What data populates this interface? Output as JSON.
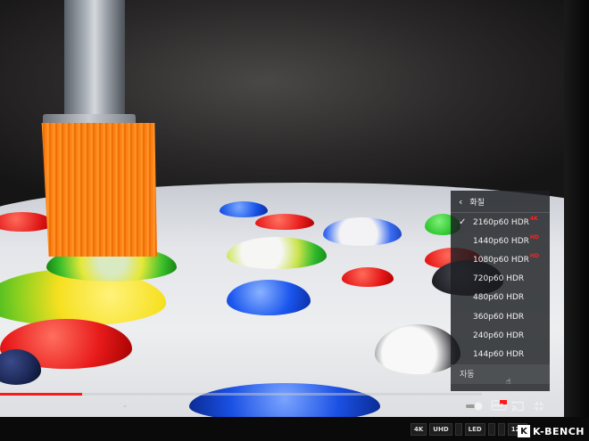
{
  "quality_menu": {
    "back_label": "화질",
    "options": [
      {
        "label": "2160p60 HDR",
        "badge": "4K",
        "selected": true
      },
      {
        "label": "1440p60 HDR",
        "badge": "HD",
        "selected": false
      },
      {
        "label": "1080p60 HDR",
        "badge": "HD",
        "selected": false
      },
      {
        "label": "720p60 HDR",
        "badge": "",
        "selected": false
      },
      {
        "label": "480p60 HDR",
        "badge": "",
        "selected": false
      },
      {
        "label": "360p60 HDR",
        "badge": "",
        "selected": false
      },
      {
        "label": "240p60 HDR",
        "badge": "",
        "selected": false
      },
      {
        "label": "144p60 HDR",
        "badge": "",
        "selected": false
      }
    ],
    "auto_label": "자동",
    "check_glyph": "✓"
  },
  "player": {
    "progress_fraction": 0.17,
    "hdr_label": "HDR",
    "accent_color": "#ff1a1a"
  },
  "icons": {
    "back": "chevron-left-icon",
    "autoplay": "autoplay-toggle-icon",
    "cast": "cast-icon",
    "fullscreen-exit": "fullscreen-exit-icon",
    "chevron": "chevron-down-icon"
  },
  "footer": {
    "logos": [
      "4K",
      "UHD",
      "",
      "LED",
      "",
      "",
      "120"
    ],
    "watermark": "K-BENCH",
    "watermark_k": "K"
  }
}
